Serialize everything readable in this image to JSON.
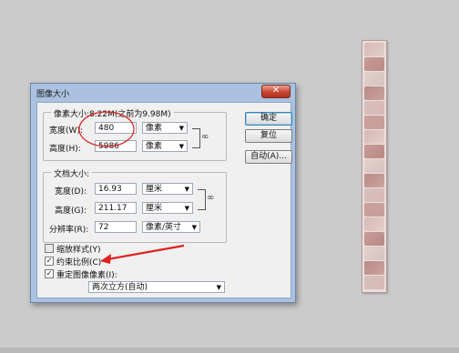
{
  "dialog": {
    "title": "图像大小",
    "close_glyph": "✕",
    "pixel_group": {
      "title": "像素大小:8.22M(之前为9.98M)",
      "width_label": "宽度(W):",
      "width_value": "480",
      "width_unit": "像素",
      "height_label": "高度(H):",
      "height_value": "5986",
      "height_unit": "像素"
    },
    "doc_group": {
      "title": "文档大小:",
      "width_label": "宽度(D):",
      "width_value": "16.93",
      "width_unit": "厘米",
      "height_label": "高度(G):",
      "height_value": "211.17",
      "height_unit": "厘米",
      "res_label": "分辨率(R):",
      "res_value": "72",
      "res_unit": "像素/英寸"
    },
    "buttons": {
      "ok": "确定",
      "reset": "复位",
      "auto": "自动(A)..."
    },
    "options": {
      "scale_styles": "缩放样式(Y)",
      "scale_styles_checked": false,
      "constrain": "约束比例(C)",
      "constrain_checked": true,
      "resample": "重定图像像素(I):",
      "resample_checked": true,
      "resample_method": "两次立方(自动)"
    },
    "chain_icon": "link-chain-icon"
  },
  "annotation_color": "#e02020"
}
